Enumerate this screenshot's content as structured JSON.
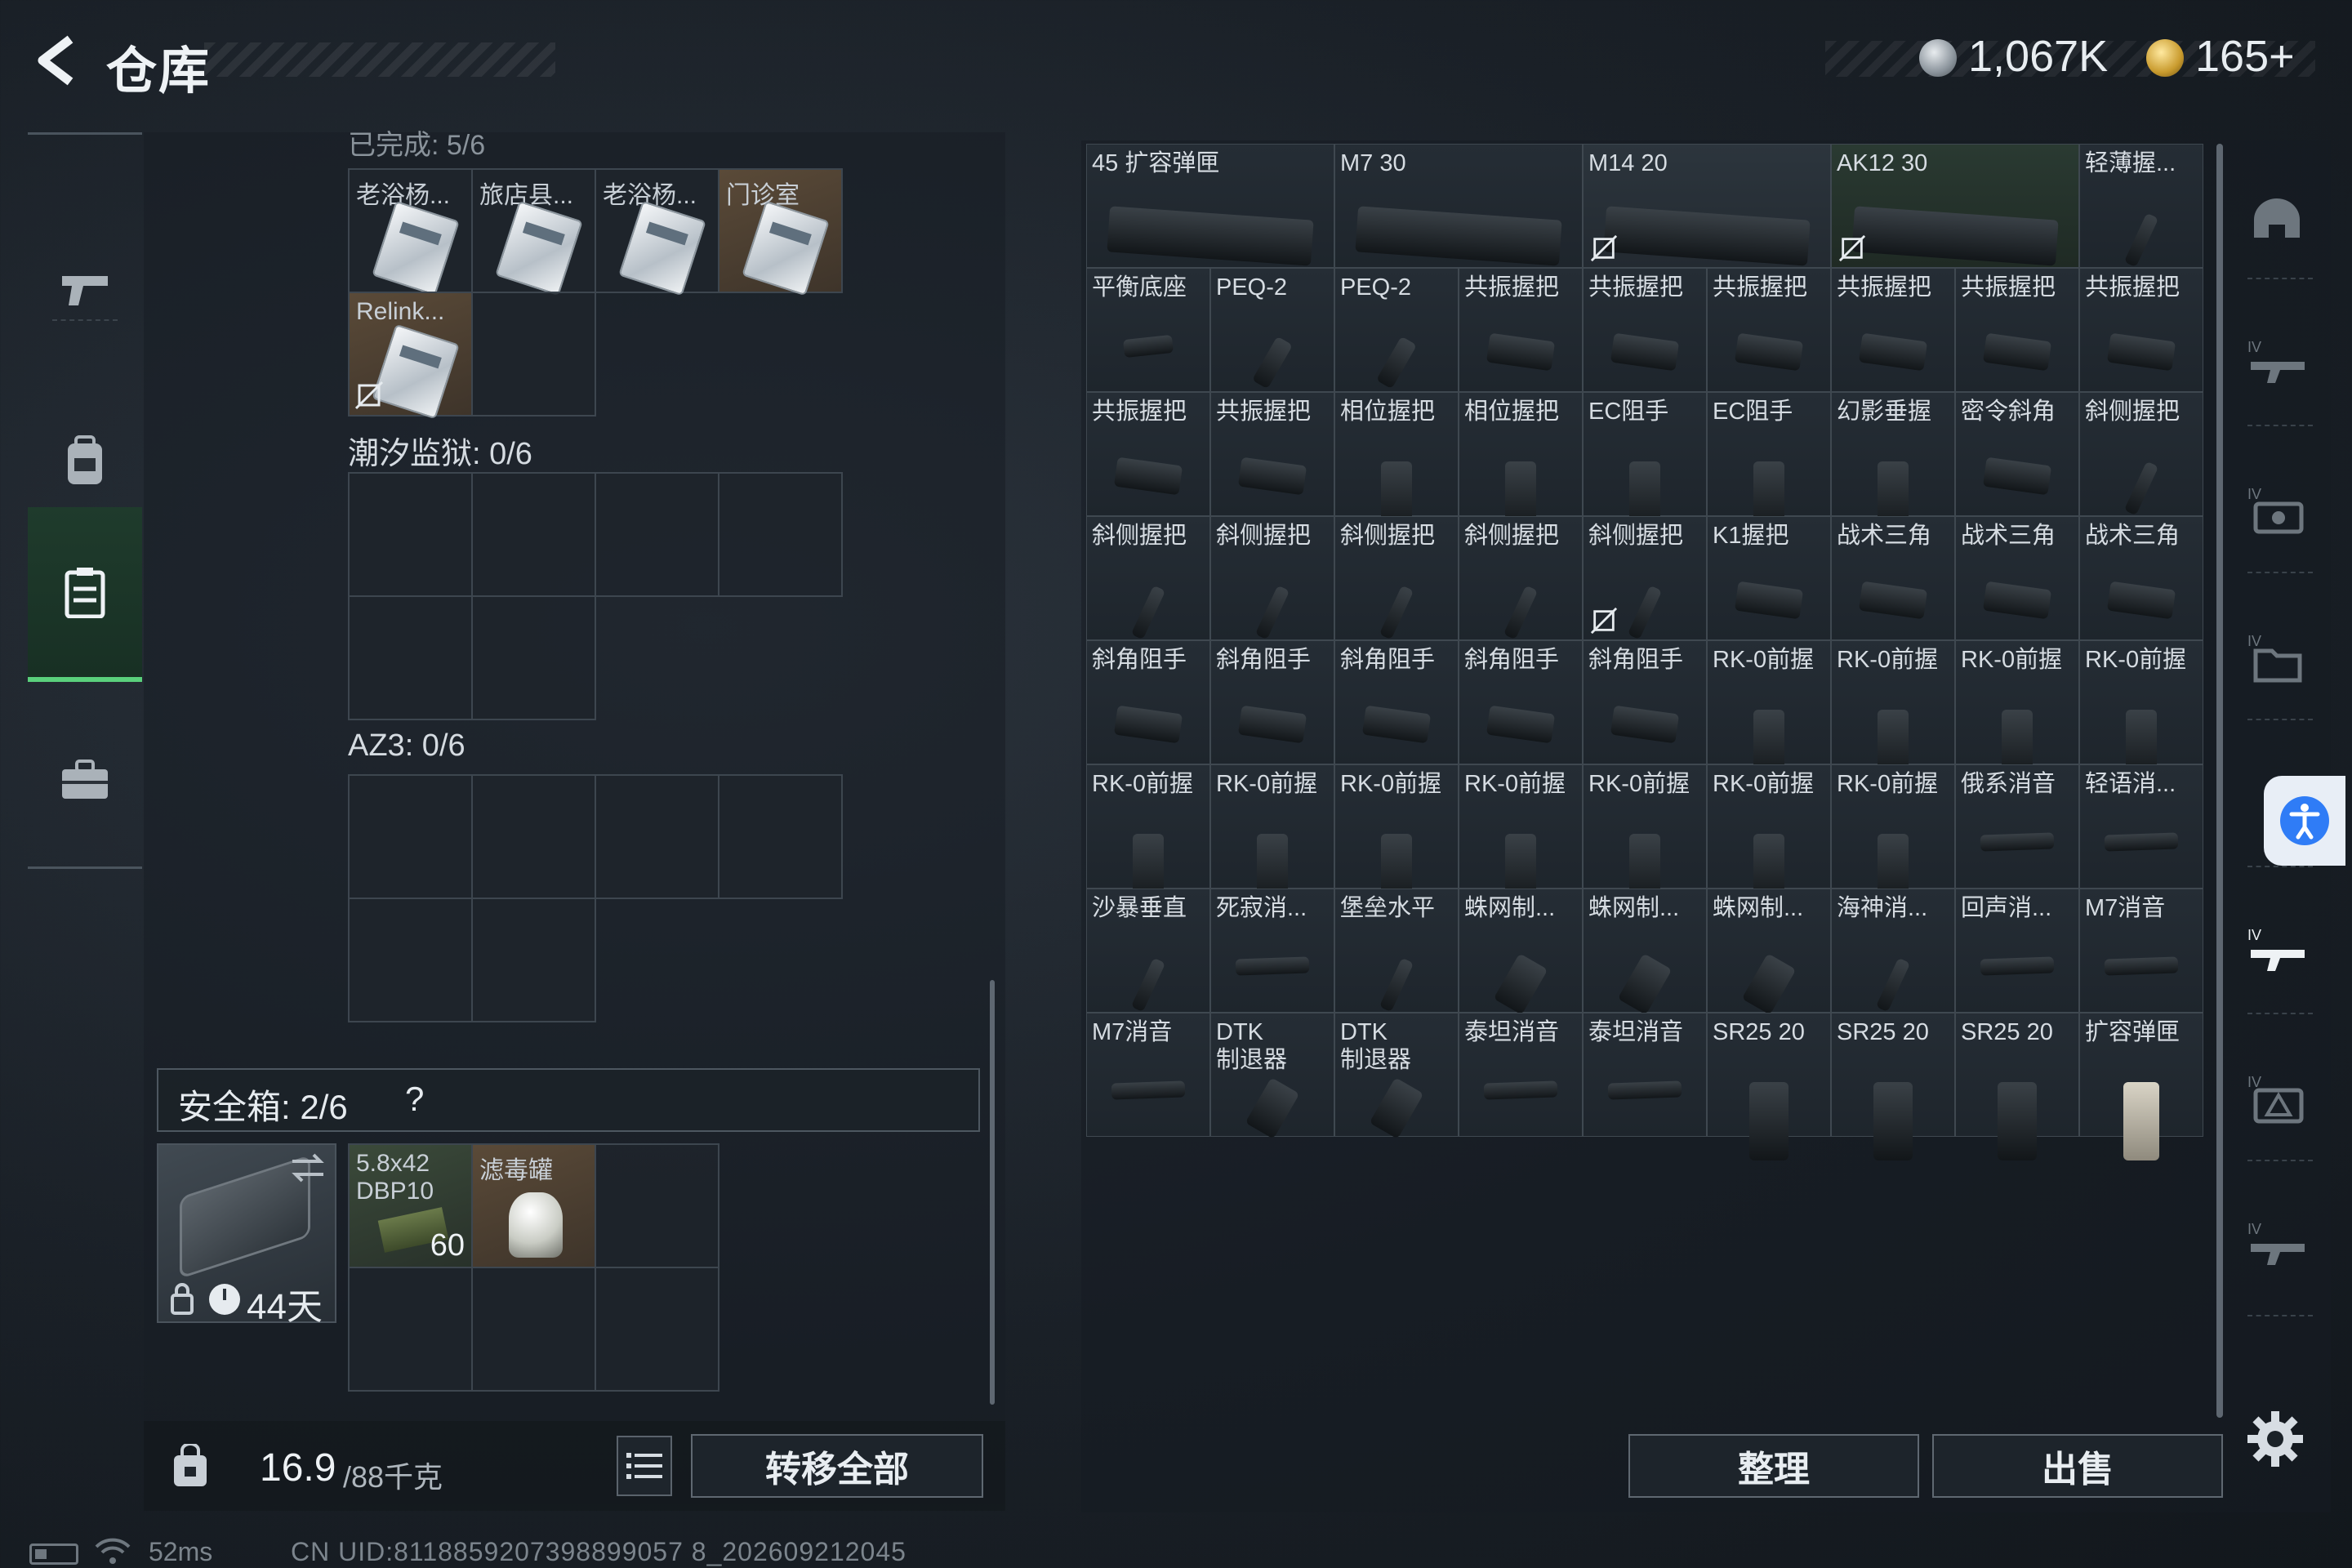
{
  "header": {
    "title": "仓库",
    "silver_amount": "1,067K",
    "gold_amount": "165+"
  },
  "left_nav": {
    "items": [
      {
        "name": "weapon-tab",
        "icon": "pistol-icon"
      },
      {
        "name": "backpack-tab",
        "icon": "backpack-icon"
      },
      {
        "name": "storage-tab",
        "icon": "storage-box-icon",
        "active": true
      },
      {
        "name": "case-tab",
        "icon": "briefcase-icon"
      }
    ]
  },
  "containers": {
    "section_1_partial": "已完成: 5/6",
    "slots_1": [
      {
        "label": "老浴杨...",
        "tan": false
      },
      {
        "label": "旅店县...",
        "tan": false
      },
      {
        "label": "老浴杨...",
        "tan": false
      },
      {
        "label": "门诊室",
        "tan": true
      },
      {
        "label": "Relink...",
        "tan": true,
        "broken": true
      }
    ],
    "section_2": "潮汐监狱: 0/6",
    "section_3": "AZ3: 0/6",
    "safebox": {
      "label": "安全箱: 2/6",
      "help": "?",
      "days": "44天",
      "items": [
        {
          "label": "5.8x42 DBP10",
          "count": "60"
        },
        {
          "label": "滤毒罐"
        }
      ]
    }
  },
  "bottom_left": {
    "weight_current": "16.9",
    "weight_max": "/88千克",
    "transfer_label": "转移全部"
  },
  "grid": {
    "rows": [
      [
        {
          "name": "45 扩容弹匣",
          "wide": true,
          "shape": "mag"
        },
        {
          "name": "M7 30",
          "wide": true,
          "shape": "mag"
        },
        {
          "name": "M14 20",
          "wide": true,
          "shape": "mag",
          "broken": true
        },
        {
          "name": "AK12 30",
          "wide": true,
          "shape": "mag",
          "broken": true
        },
        {
          "name": "轻薄握...",
          "shape": "stick"
        }
      ],
      [
        {
          "name": "平衡底座",
          "shape": "flat"
        },
        {
          "name": "PEQ-2",
          "shape": "laser"
        },
        {
          "name": "PEQ-2",
          "shape": "laser"
        },
        {
          "name": "共振握把",
          "shape": "grip"
        },
        {
          "name": "共振握把",
          "shape": "grip"
        },
        {
          "name": "共振握把",
          "shape": "grip"
        },
        {
          "name": "共振握把",
          "shape": "grip"
        },
        {
          "name": "共振握把",
          "shape": "grip"
        },
        {
          "name": "共振握把",
          "shape": "grip"
        }
      ],
      [
        {
          "name": "共振握把",
          "shape": "grip"
        },
        {
          "name": "共振握把",
          "shape": "grip"
        },
        {
          "name": "相位握把",
          "shape": "vgrip"
        },
        {
          "name": "相位握把",
          "shape": "vgrip"
        },
        {
          "name": "EC阻手",
          "shape": "vgrip"
        },
        {
          "name": "EC阻手",
          "shape": "vgrip"
        },
        {
          "name": "幻影垂握",
          "shape": "vgrip"
        },
        {
          "name": "密令斜角",
          "shape": "grip"
        },
        {
          "name": "斜侧握把",
          "shape": "stick"
        }
      ],
      [
        {
          "name": "斜侧握把",
          "shape": "stick"
        },
        {
          "name": "斜侧握把",
          "shape": "stick"
        },
        {
          "name": "斜侧握把",
          "shape": "stick"
        },
        {
          "name": "斜侧握把",
          "shape": "stick"
        },
        {
          "name": "斜侧握把",
          "shape": "stick",
          "broken": true
        },
        {
          "name": "K1握把",
          "shape": "grip"
        },
        {
          "name": "战术三角",
          "shape": "grip"
        },
        {
          "name": "战术三角",
          "shape": "grip"
        },
        {
          "name": "战术三角",
          "shape": "grip"
        }
      ],
      [
        {
          "name": "斜角阻手",
          "shape": "grip"
        },
        {
          "name": "斜角阻手",
          "shape": "grip"
        },
        {
          "name": "斜角阻手",
          "shape": "grip"
        },
        {
          "name": "斜角阻手",
          "shape": "grip"
        },
        {
          "name": "斜角阻手",
          "shape": "grip"
        },
        {
          "name": "RK-0前握",
          "shape": "vgrip"
        },
        {
          "name": "RK-0前握",
          "shape": "vgrip"
        },
        {
          "name": "RK-0前握",
          "shape": "vgrip"
        },
        {
          "name": "RK-0前握",
          "shape": "vgrip"
        }
      ],
      [
        {
          "name": "RK-0前握",
          "shape": "vgrip"
        },
        {
          "name": "RK-0前握",
          "shape": "vgrip"
        },
        {
          "name": "RK-0前握",
          "shape": "vgrip"
        },
        {
          "name": "RK-0前握",
          "shape": "vgrip"
        },
        {
          "name": "RK-0前握",
          "shape": "vgrip"
        },
        {
          "name": "RK-0前握",
          "shape": "vgrip"
        },
        {
          "name": "RK-0前握",
          "shape": "vgrip"
        },
        {
          "name": "俄系消音",
          "shape": "tube"
        },
        {
          "name": "轻语消...",
          "shape": "tube"
        }
      ],
      [
        {
          "name": "沙暴垂直",
          "shape": "stick"
        },
        {
          "name": "死寂消...",
          "shape": "tube"
        },
        {
          "name": "堡垒水平",
          "shape": "stick"
        },
        {
          "name": "蛛网制...",
          "shape": "brake"
        },
        {
          "name": "蛛网制...",
          "shape": "brake"
        },
        {
          "name": "蛛网制...",
          "shape": "brake"
        },
        {
          "name": "海神消...",
          "shape": "stick"
        },
        {
          "name": "回声消...",
          "shape": "tube"
        },
        {
          "name": "M7消音",
          "shape": "tube"
        }
      ],
      [
        {
          "name": "M7消音",
          "shape": "tube"
        },
        {
          "name": "DTK\n制退器",
          "shape": "brake"
        },
        {
          "name": "DTK\n制退器",
          "shape": "brake"
        },
        {
          "name": "泰坦消音",
          "shape": "tube"
        },
        {
          "name": "泰坦消音",
          "shape": "tube"
        },
        {
          "name": "SR25 20",
          "shape": "tallmag"
        },
        {
          "name": "SR25 20",
          "shape": "tallmag"
        },
        {
          "name": "SR25 20",
          "shape": "tallmag"
        },
        {
          "name": "扩容弹匣",
          "shape": "tallmag-light"
        }
      ]
    ]
  },
  "grid_buttons": {
    "sort_label": "整理",
    "sell_label": "出售"
  },
  "side_tabs": [
    {
      "name": "helmet-tab",
      "icon": "helmet-icon"
    },
    {
      "name": "tier4-rifle-tab",
      "icon": "rifle-icon"
    },
    {
      "name": "tier4-case-tab",
      "icon": "medkit-icon"
    },
    {
      "name": "tier4-file-tab",
      "icon": "folder-icon"
    },
    {
      "name": "tier4-rifle-active-tab",
      "icon": "rifle-icon"
    },
    {
      "name": "tier4-triangle-tab",
      "icon": "triangle-icon"
    },
    {
      "name": "tier4-gun-tab",
      "icon": "gun-icon"
    }
  ],
  "status": {
    "ping": "52ms",
    "uid": "CN UID:8118859207398899057 8_202609212045"
  }
}
